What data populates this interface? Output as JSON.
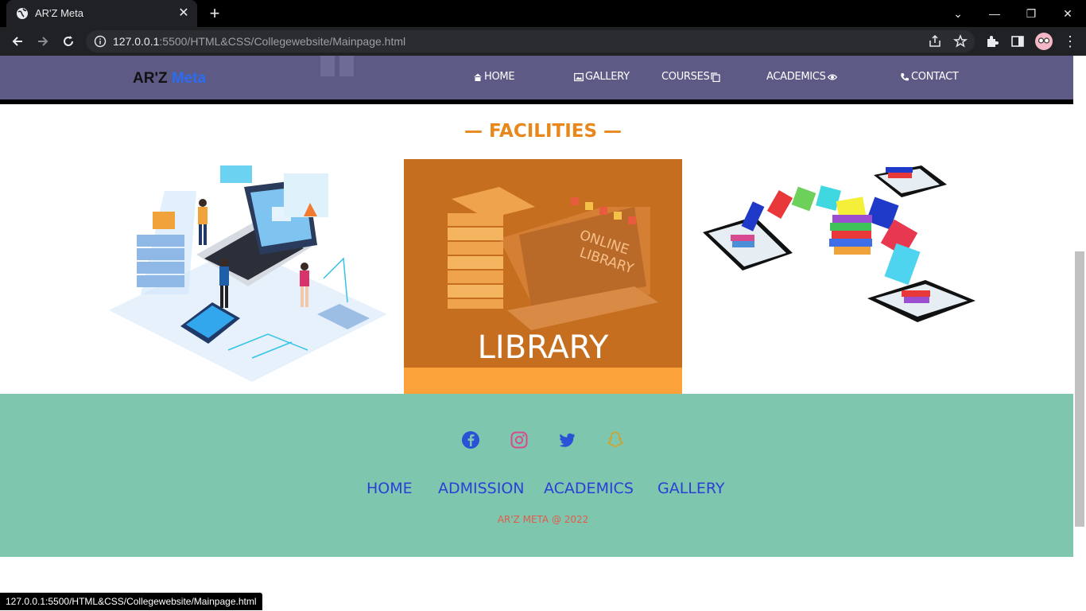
{
  "browser": {
    "tab_title": "AR'Z Meta",
    "url_host": "127.0.0.1",
    "url_path": ":5500/HTML&CSS/Collegewebsite/Mainpage.html",
    "status_url": "127.0.0.1:5500/HTML&CSS/Collegewebsite/Mainpage.html"
  },
  "brand": {
    "part1": "AR'Z ",
    "part2": "Meta"
  },
  "nav": {
    "home": "HOME",
    "gallery": "GALLERY",
    "courses": "COURSES",
    "academics": "ACADEMICS",
    "contact": "CONTACT"
  },
  "facilities": {
    "heading": "— FACILITIES —",
    "cards": [
      {
        "image": "computer-lab-illustration"
      },
      {
        "image": "online-library-illustration",
        "label": "LIBRARY"
      },
      {
        "image": "books-tablets-illustration"
      }
    ]
  },
  "footer": {
    "social": [
      "facebook-icon",
      "instagram-icon",
      "twitter-icon",
      "snapchat-icon"
    ],
    "links": [
      "HOME",
      "ADMISSION",
      "ACADEMICS",
      "GALLERY"
    ],
    "copyright": "AR'Z META @ 2022"
  },
  "colors": {
    "navbar": "#5d5a86",
    "heading": "#e8871c",
    "footer": "#7ec7ae",
    "footer_links": "#2a3fd6",
    "copyright": "#e35a4a"
  }
}
